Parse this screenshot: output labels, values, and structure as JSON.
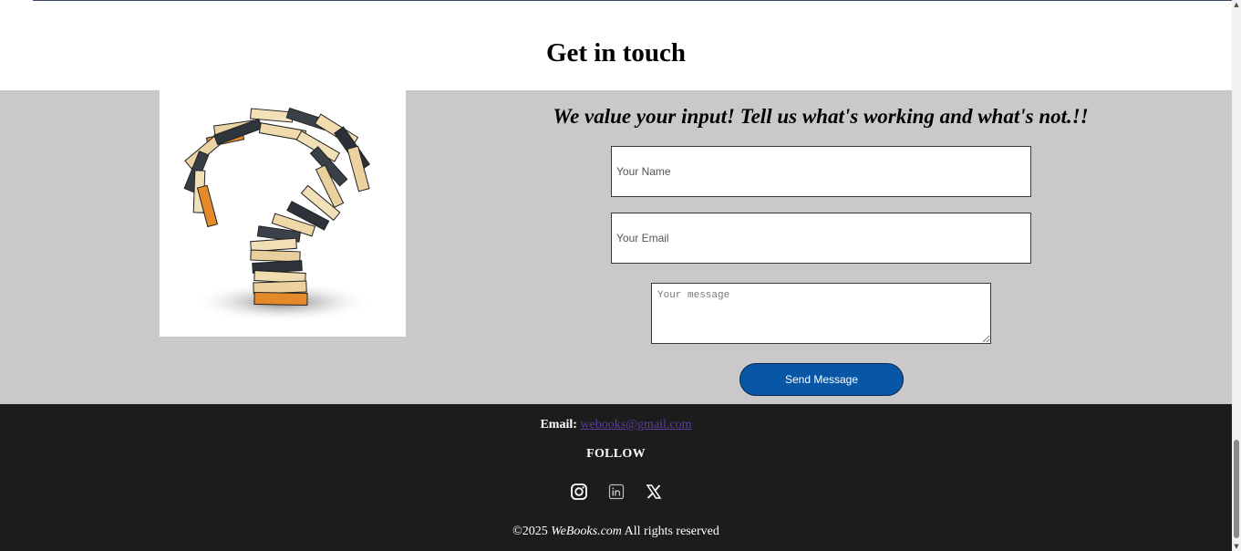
{
  "contact": {
    "title": "Get in touch",
    "tagline": "We value your input! Tell us what's working and what's not.!!",
    "image_subject": "question-mark-made-of-books",
    "form": {
      "name_placeholder": "Your Name",
      "email_placeholder": "Your Email",
      "message_placeholder": "Your message",
      "send_label": "Send Message"
    }
  },
  "footer": {
    "email_label": "Email:",
    "email_link": "webooks@gmail.com",
    "follow_label": "FOLLOW",
    "socials": [
      "instagram-icon",
      "linkedin-icon",
      "x-icon"
    ],
    "copyright_prefix": "©2025",
    "copyright_brand": "WeBooks.com",
    "copyright_suffix": "All rights reserved"
  },
  "colors": {
    "section_bg": "#c9c9c9",
    "footer_bg": "#1c1c1c",
    "button_bg": "#0757a6",
    "link": "#5a3fa0"
  }
}
